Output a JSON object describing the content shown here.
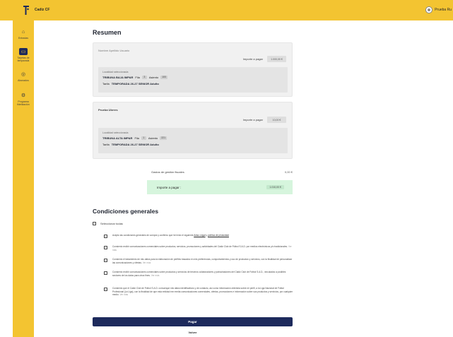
{
  "header": {
    "app_title": "Cadiz CF",
    "user_name": "Prueba Ru"
  },
  "sidebar": {
    "items": [
      {
        "icon": "home-icon",
        "label": "Entradas"
      },
      {
        "icon": "ticket-icon",
        "label": "Tarjetas de temporada"
      },
      {
        "icon": "shop-icon",
        "label": "Abonados"
      },
      {
        "icon": "settings-icon",
        "label": "Programa fidelización"
      }
    ]
  },
  "summary": {
    "title": "Resumen",
    "cards": [
      {
        "title": "Nombre Apellido Usuario",
        "title_muted": true,
        "price_label": "Importe a pagar",
        "price_value": "1.000,00 €",
        "location_caption": "Localidad seleccionada",
        "stand": "TRIBUNA BAJA IMPAR",
        "row_label": "Fila",
        "row_value": "3",
        "seat_label": "Asiento",
        "seat_value": "100",
        "rate_label": "Tarifa",
        "rate_value": "TEMPORADA 26-27 SENIOR Adulto"
      },
      {
        "title": "Prueba Ubrres",
        "title_muted": false,
        "price_label": "Importe a pagar",
        "price_value": "10,00 €",
        "location_caption": "Localidad seleccionada",
        "stand": "TRIBUNA ALTA IMPAR",
        "row_label": "Fila",
        "row_value": "1",
        "seat_label": "Asiento",
        "seat_value": "221",
        "rate_label": "Tarifa",
        "rate_value": "TEMPORADA 26-27 SENIOR Adulto"
      }
    ],
    "fee_label": "Gastos de gestión fiscales",
    "fee_value": "0,00 €",
    "total_label": "Importe a pagar :",
    "total_value": "1.010,00 €"
  },
  "conditions": {
    "title": "Condiciones generales",
    "select_all": "Seleccionar todas",
    "items": [
      {
        "text": "Acepto las condiciones generales de compra y confirmo que he leído el siguiente ",
        "link1": "Aviso Legal",
        "mid": " y ",
        "link2": "política de privacidad",
        "more": ""
      },
      {
        "text": "Consiento recibir comunicaciones comerciales sobre productos, servicios, promociones y actividades del Cádiz Club de Fútbol S.A.D. por medios electrónicos y/o tradicionales.",
        "link1": "",
        "mid": "",
        "link2": "",
        "more": " Ver más"
      },
      {
        "text": "Consiento el tratamiento de mis datos para la elaboración de perfiles basados en mis preferencias, comportamientos y uso de productos y servicios, con la finalidad de personalizar las comunicaciones y ofertas.",
        "link1": "",
        "mid": "",
        "link2": "",
        "more": " Ver más"
      },
      {
        "text": "Consiento recibir comunicaciones comerciales sobre productos y servicios de terceros colaboradores y patrocinadores del Cádiz Club de Fútbol S.A.D., vinculados a posibles sectores de los datos para otros fines.",
        "link1": "",
        "mid": "",
        "link2": "",
        "more": " Ver más"
      },
      {
        "text": "Consiento que el Cádiz Club de Fútbol S.A.D. comunique mis datos identificativos y de contacto, así como información obtenida sobre mi perfil, a la Liga Nacional de Fútbol Profesional (La Liga), con la finalidad de que esta entidad me remita comunicaciones comerciales, ofertas, promociones e información sobre sus productos y servicios, por cualquier medio.",
        "link1": "",
        "mid": "",
        "link2": "",
        "more": " Ver más"
      }
    ]
  },
  "actions": {
    "pay_label": "Pagar",
    "back_label": "Volver"
  }
}
